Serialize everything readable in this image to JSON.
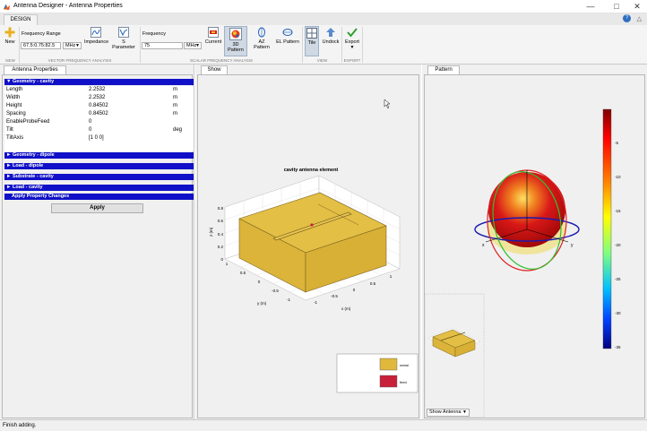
{
  "window": {
    "title": "Antenna Designer - Antenna Properties"
  },
  "toolstrip": {
    "tab": "DESIGN",
    "new_label": "New",
    "frequency_range_label": "Frequency Range",
    "frequency_range_value": "67.5:0.75:82.5",
    "frequency_range_unit": "MHz",
    "impedance_label": "Impedance",
    "sparameter_label": "S Parameter",
    "frequency_label": "Frequency",
    "frequency_value": "75",
    "frequency_unit": "MHz",
    "current_label": "Current",
    "pattern3d_label": "3D Pattern",
    "az_pattern_label": "AZ Pattern",
    "el_pattern_label": "EL Pattern",
    "tile_label": "Tile",
    "undock_label": "Undock",
    "export_label": "Export",
    "sections": [
      "NEW",
      "VECTOR FREQUENCY ANALYSIS",
      "SCALAR FREQUENCY ANALYSIS",
      "VIEW",
      "EXPORT"
    ]
  },
  "left_panel": {
    "tab": "Antenna Properties",
    "geometry_header": "Geometry - cavity",
    "properties": [
      {
        "name": "Length",
        "value": "2.2532",
        "unit": "m"
      },
      {
        "name": "Width",
        "value": "2.2532",
        "unit": "m"
      },
      {
        "name": "Height",
        "value": "0.84502",
        "unit": "m"
      },
      {
        "name": "Spacing",
        "value": "0.84502",
        "unit": "m"
      },
      {
        "name": "EnableProbeFeed",
        "value": "0",
        "unit": ""
      },
      {
        "name": "Tilt",
        "value": "0",
        "unit": "deg"
      },
      {
        "name": "TiltAxis",
        "value": "[1 0 0]",
        "unit": ""
      }
    ],
    "collapsed_sections": [
      "Geometry - dipole",
      "Load - dipole",
      "Substrate - cavity",
      "Load - cavity"
    ],
    "apply_changes_header": "Apply Property Changes",
    "apply_button": "Apply"
  },
  "show_panel": {
    "tab": "Show",
    "plot_title": "cavity antenna element",
    "x_axis_label": "x (m)",
    "y_axis_label": "y (m)",
    "z_axis_label": "z (m)",
    "z_ticks": [
      "0",
      "0.2",
      "0.4",
      "0.6",
      "0.8"
    ],
    "x_ticks": [
      "-1",
      "-0.5",
      "0",
      "0.5",
      "1"
    ],
    "y_ticks": [
      "1",
      "0.5",
      "0",
      "-0.5",
      "-1"
    ],
    "legend_metal": "metal",
    "legend_feed": "feed",
    "metal_color": "#e0b83c",
    "feed_color": "#c8203a"
  },
  "pattern_panel": {
    "tab": "Pattern",
    "colorbar_ticks": [
      "-5",
      "-10",
      "-15",
      "-20",
      "-25",
      "-30",
      "-35"
    ],
    "axis_x": "x",
    "axis_y": "y",
    "axis_z": "z",
    "show_dropdown": "Show Antenna"
  },
  "status": {
    "text": "Finish adding."
  }
}
